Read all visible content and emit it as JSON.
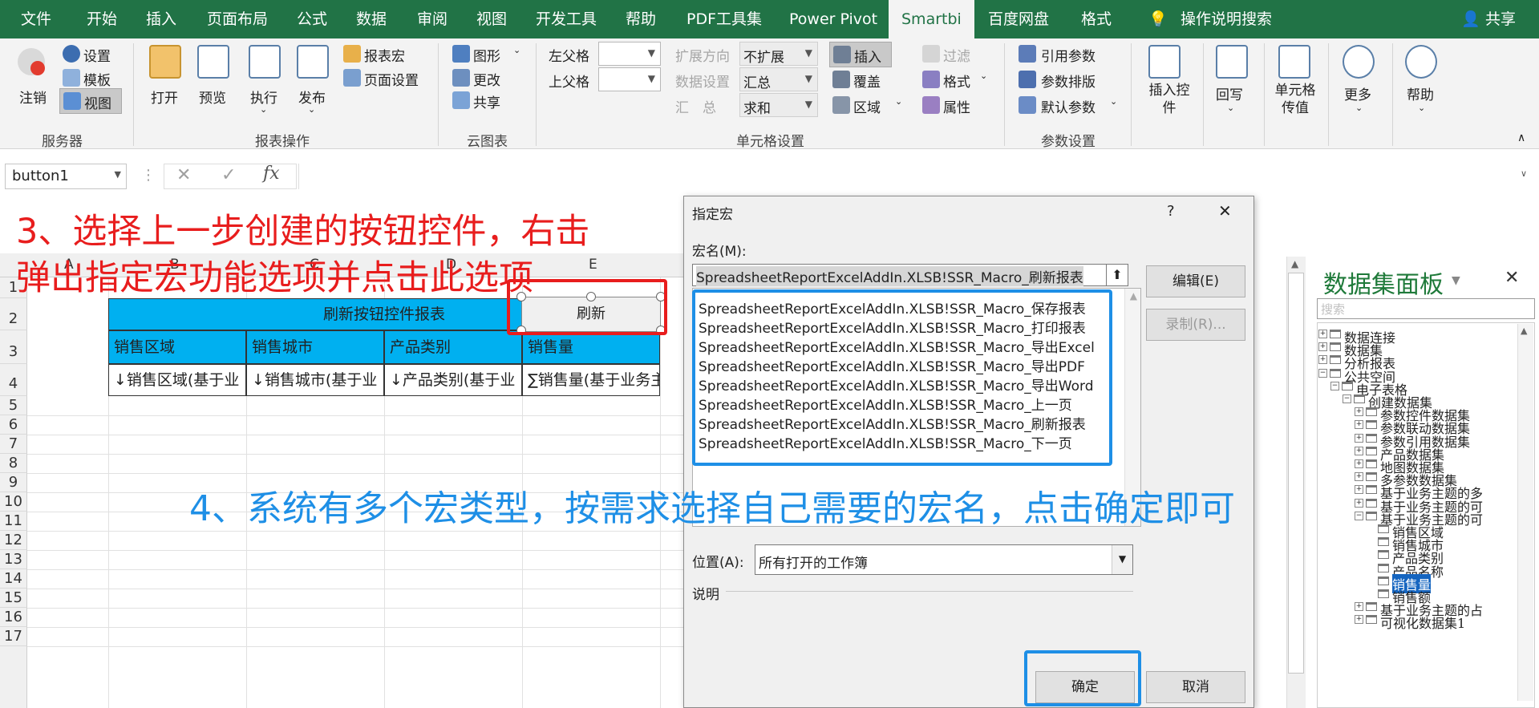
{
  "tabs": [
    "文件",
    "开始",
    "插入",
    "页面布局",
    "公式",
    "数据",
    "审阅",
    "视图",
    "开发工具",
    "帮助",
    "PDF工具集",
    "Power Pivot",
    "Smartbi",
    "百度网盘",
    "格式"
  ],
  "tab_search": "操作说明搜索",
  "tab_share": "共享",
  "ribbon": {
    "logout": "注销",
    "settings": "设置",
    "template": "模板",
    "view": "视图",
    "server_group": "服务器",
    "open": "打开",
    "preview": "预览",
    "execute": "执行",
    "publish": "发布",
    "report_macro": "报表宏",
    "page_setup": "页面设置",
    "report_ops_group": "报表操作",
    "chart": "图形",
    "change": "更改",
    "share": "共享",
    "cloud_chart_group": "云图表",
    "left_parent": "左父格",
    "top_parent": "上父格",
    "expand_dir": "扩展方向",
    "data_setting": "数据设置",
    "summary": "汇　总",
    "no_expand": "不扩展",
    "aggregate": "汇总",
    "sum": "求和",
    "insert": "插入",
    "cover": "覆盖",
    "region": "区域",
    "cell_setting_group": "单元格设置",
    "filter": "过滤",
    "format": "格式",
    "attribute": "属性",
    "ref_param": "引用参数",
    "param_layout": "参数排版",
    "default_param": "默认参数",
    "param_setting_group": "参数设置",
    "insert_control": "插入控件",
    "write_back": "回写",
    "cell_pass": "单元格传值",
    "more": "更多",
    "help": "帮助"
  },
  "formula": {
    "name_box": "button1",
    "cancel": "✕",
    "confirm": "✓",
    "fx": "fx"
  },
  "grid": {
    "rows": [
      "1",
      "2",
      "3",
      "4",
      "5",
      "6",
      "7",
      "8",
      "9",
      "10",
      "11",
      "12",
      "13",
      "14",
      "15",
      "16",
      "17"
    ],
    "cols": [
      "A",
      "B",
      "C",
      "D",
      "E"
    ],
    "title": "刷新按钮控件报表",
    "headers": [
      "销售区域",
      "销售城市",
      "产品类别",
      "销售量"
    ],
    "row4": [
      "↓销售区域(基于业",
      "↓销售城市(基于业",
      "↓产品类别(基于业",
      "∑销售量(基于业务主"
    ],
    "button_label": "刷新"
  },
  "annotations": {
    "step3_line1": "3、选择上一步创建的按钮控件，右击",
    "step3_line2": "弹出指定宏功能选项并点击此选项",
    "step4": "4、系统有多个宏类型，按需求选择自己需要的宏名，点击确定即可"
  },
  "dialog": {
    "title": "指定宏",
    "help": "?",
    "close": "✕",
    "macro_name_label": "宏名(M):",
    "macro_name_value": "SpreadsheetReportExcelAddIn.XLSB!SSR_Macro_刷新报表",
    "macros": [
      "SpreadsheetReportExcelAddIn.XLSB!SSR_Macro_保存报表",
      "SpreadsheetReportExcelAddIn.XLSB!SSR_Macro_打印报表",
      "SpreadsheetReportExcelAddIn.XLSB!SSR_Macro_导出Excel",
      "SpreadsheetReportExcelAddIn.XLSB!SSR_Macro_导出PDF",
      "SpreadsheetReportExcelAddIn.XLSB!SSR_Macro_导出Word",
      "SpreadsheetReportExcelAddIn.XLSB!SSR_Macro_上一页",
      "SpreadsheetReportExcelAddIn.XLSB!SSR_Macro_刷新报表",
      "SpreadsheetReportExcelAddIn.XLSB!SSR_Macro_下一页"
    ],
    "edit_btn": "编辑(E)",
    "record_btn": "录制(R)...",
    "location_label": "位置(A):",
    "location_value": "所有打开的工作簿",
    "desc_label": "说明",
    "ok_btn": "确定",
    "cancel_btn": "取消"
  },
  "panel": {
    "title": "数据集面板",
    "close": "✕",
    "search_placeholder": "搜索",
    "tree": [
      {
        "label": "数据连接",
        "level": 0,
        "exp": "+"
      },
      {
        "label": "数据集",
        "level": 0,
        "exp": "+"
      },
      {
        "label": "分析报表",
        "level": 0,
        "exp": "+"
      },
      {
        "label": "公共空间",
        "level": 0,
        "exp": "-"
      },
      {
        "label": "电子表格",
        "level": 1,
        "exp": "-"
      },
      {
        "label": "创建数据集",
        "level": 2,
        "exp": "-"
      },
      {
        "label": "参数控件数据集",
        "level": 3,
        "exp": "+"
      },
      {
        "label": "参数联动数据集",
        "level": 3,
        "exp": "+"
      },
      {
        "label": "参数引用数据集",
        "level": 3,
        "exp": "+"
      },
      {
        "label": "产品数据集",
        "level": 3,
        "exp": "+"
      },
      {
        "label": "地图数据集",
        "level": 3,
        "exp": "+"
      },
      {
        "label": "多参数数据集",
        "level": 3,
        "exp": "+"
      },
      {
        "label": "基于业务主题的多",
        "level": 3,
        "exp": "+"
      },
      {
        "label": "基于业务主题的可",
        "level": 3,
        "exp": "+"
      },
      {
        "label": "基于业务主题的可",
        "level": 3,
        "exp": "-"
      },
      {
        "label": "销售区域",
        "level": 4,
        "exp": ""
      },
      {
        "label": "销售城市",
        "level": 4,
        "exp": ""
      },
      {
        "label": "产品类别",
        "level": 4,
        "exp": ""
      },
      {
        "label": "产品名称",
        "level": 4,
        "exp": ""
      },
      {
        "label": "销售量",
        "level": 4,
        "exp": "",
        "selected": true
      },
      {
        "label": "销售额",
        "level": 4,
        "exp": ""
      },
      {
        "label": "基于业务主题的占",
        "level": 3,
        "exp": "+"
      },
      {
        "label": "可视化数据集1",
        "level": 3,
        "exp": "+"
      }
    ]
  }
}
